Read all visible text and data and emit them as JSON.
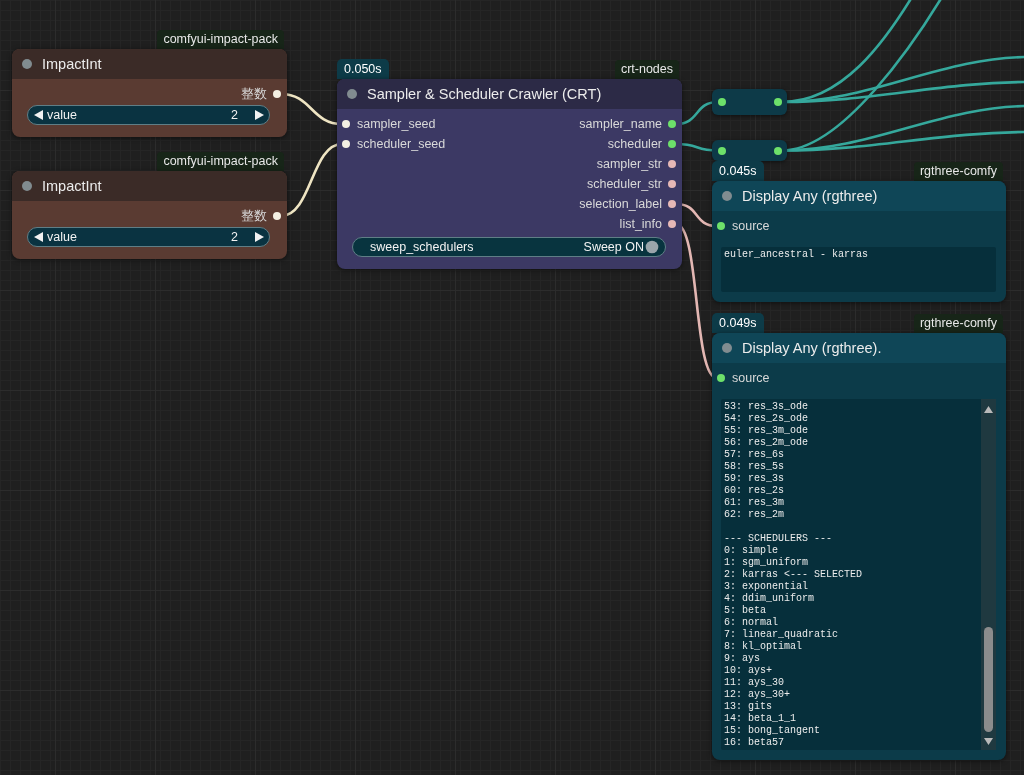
{
  "canvas": {
    "nodes": [
      {
        "kind": "node",
        "source": "comfyui-impact-pack",
        "title_bar": {
          "title": "ImpactInt",
          "color": "#3b2b27"
        },
        "color": "#5a3b32",
        "outputs": [
          {
            "label": "整数",
            "color": "#f3efe2",
            "links": [
              {
                "color": "#efe5c3"
              }
            ]
          }
        ],
        "widgets": [
          {
            "kind": "number",
            "label": "value",
            "value": "2"
          }
        ]
      },
      {
        "kind": "node",
        "source": "comfyui-impact-pack",
        "title_bar": {
          "title": "ImpactInt",
          "color": "#3b2b27"
        },
        "color": "#5a3b32",
        "outputs": [
          {
            "label": "整数",
            "color": "#f3efe2",
            "links": [
              {
                "color": "#efe5c3"
              }
            ]
          }
        ],
        "widgets": [
          {
            "kind": "number",
            "label": "value",
            "value": "2"
          }
        ]
      },
      {
        "kind": "node",
        "timing": "0.050s",
        "source": "crt-nodes",
        "title_bar": {
          "title": "Sampler & Scheduler Crawler (CRT)",
          "color": "#2c2a46"
        },
        "color": "#3c3964",
        "inputs": [
          {
            "label": "sampler_seed",
            "color": "#f3efe2"
          },
          {
            "label": "scheduler_seed",
            "color": "#f3efe2"
          }
        ],
        "outputs": [
          {
            "label": "sampler_name",
            "color": "#6de06a",
            "links": [
              {
                "color": "#35a89c"
              }
            ]
          },
          {
            "label": "scheduler",
            "color": "#6de06a",
            "links": [
              {
                "color": "#35a89c"
              }
            ]
          },
          {
            "label": "sampler_str",
            "color": "#e6b8b6"
          },
          {
            "label": "scheduler_str",
            "color": "#e6b8b6"
          },
          {
            "label": "selection_label",
            "color": "#e6b8b6",
            "links": [
              {
                "color": "#e3b7b3"
              }
            ]
          },
          {
            "label": "list_info",
            "color": "#e6b8b6",
            "links": [
              {
                "color": "#e3b7b3"
              }
            ]
          }
        ],
        "widgets": [
          {
            "kind": "toggle",
            "label": "sweep_schedulers",
            "value": "Sweep ON",
            "on": true
          }
        ]
      },
      {
        "kind": "reroute",
        "color": "#0d3a48",
        "inputs": [
          {
            "color": "#6de06a"
          }
        ],
        "outputs": [
          {
            "color": "#6de06a",
            "links": [
              {
                "color": "#35a89c"
              },
              {
                "color": "#35a89c"
              },
              {
                "color": "#35a89c"
              }
            ]
          }
        ]
      },
      {
        "kind": "reroute",
        "color": "#0d3a48",
        "inputs": [
          {
            "color": "#6de06a"
          }
        ],
        "outputs": [
          {
            "color": "#6de06a",
            "links": [
              {
                "color": "#35a89c"
              },
              {
                "color": "#35a89c"
              },
              {
                "color": "#35a89c"
              }
            ]
          }
        ]
      },
      {
        "kind": "node",
        "timing": "0.045s",
        "source": "rgthree-comfy",
        "title_bar": {
          "title": "Display Any (rgthree)",
          "color": "#0f4657"
        },
        "color": "#0c3b49",
        "inputs": [
          {
            "label": "source",
            "color": "#6de06a"
          }
        ],
        "widgets": [
          {
            "kind": "text",
            "value": "euler_ancestral - karras"
          }
        ]
      },
      {
        "kind": "node",
        "timing": "0.049s",
        "source": "rgthree-comfy",
        "title_bar": {
          "title": "Display Any (rgthree).",
          "color": "#0f4657"
        },
        "color": "#0c3b49",
        "inputs": [
          {
            "label": "source",
            "color": "#6de06a"
          }
        ],
        "widgets": [
          {
            "kind": "text",
            "value": "53: res_3s_ode\n54: res_2s_ode\n55: res_3m_ode\n56: res_2m_ode\n57: res_6s\n58: res_5s\n59: res_3s\n60: res_2s\n61: res_3m\n62: res_2m\n\n--- SCHEDULERS ---\n0: simple\n1: sgm_uniform\n2: karras <--- SELECTED\n3: exponential\n4: ddim_uniform\n5: beta\n6: normal\n7: linear_quadratic\n8: kl_optimal\n9: ays\n10: ays+\n11: ays_30\n12: ays_30+\n13: gits\n14: beta_1_1\n15: bong_tangent\n16: beta57"
          }
        ]
      }
    ]
  }
}
